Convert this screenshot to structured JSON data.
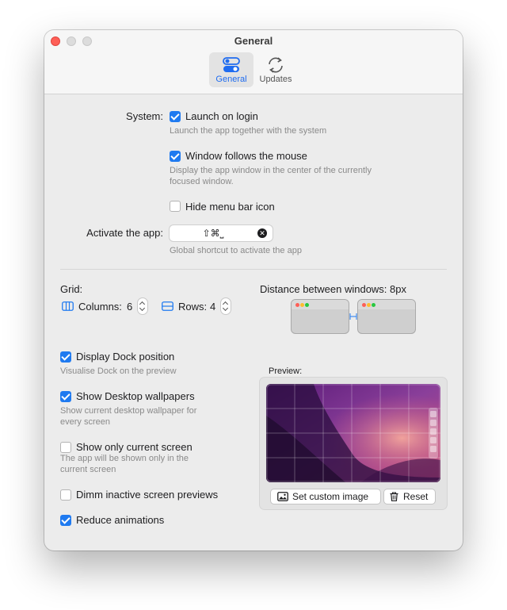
{
  "window": {
    "title": "General"
  },
  "tabs": [
    {
      "label": "General",
      "icon": "toggles-icon",
      "active": true
    },
    {
      "label": "Updates",
      "icon": "refresh-icon",
      "active": false
    }
  ],
  "system": {
    "label": "System:",
    "launch_on_login": {
      "label": "Launch on login",
      "checked": true,
      "hint": "Launch the app together with the system"
    },
    "window_follows_mouse": {
      "label": "Window follows the mouse",
      "checked": true,
      "hint_line1": "Display the app window in the center of the currently",
      "hint_line2": "focused window."
    },
    "hide_menu_bar_icon": {
      "label": "Hide menu bar icon",
      "checked": false
    }
  },
  "activate": {
    "label": "Activate the app:",
    "shortcut": "⇧⌘⎵",
    "hint": "Global shortcut to activate the app"
  },
  "grid": {
    "label": "Grid:",
    "columns_label": "Columns:",
    "columns_value": "6",
    "rows_label": "Rows:",
    "rows_value": "4"
  },
  "distance": {
    "label": "Distance between windows: 8px"
  },
  "options": {
    "display_dock": {
      "label": "Display Dock position",
      "checked": true,
      "hint": "Visualise Dock on the preview"
    },
    "show_wallpapers": {
      "label": "Show Desktop wallpapers",
      "checked": true,
      "hint_line1": "Show current desktop wallpaper for",
      "hint_line2": "every screen"
    },
    "only_current_screen": {
      "label": "Show only current screen",
      "checked": false,
      "hint_line1": "The app will be shown only in the",
      "hint_line2": "current screen"
    },
    "dimm_inactive": {
      "label": "Dimm inactive screen previews",
      "checked": false
    },
    "reduce_animations": {
      "label": "Reduce animations",
      "checked": true
    }
  },
  "preview": {
    "label": "Preview:",
    "set_image_button": "Set custom image",
    "reset_button": "Reset"
  },
  "colors": {
    "accent": "#1f7af0",
    "close": "#fe5f57"
  }
}
